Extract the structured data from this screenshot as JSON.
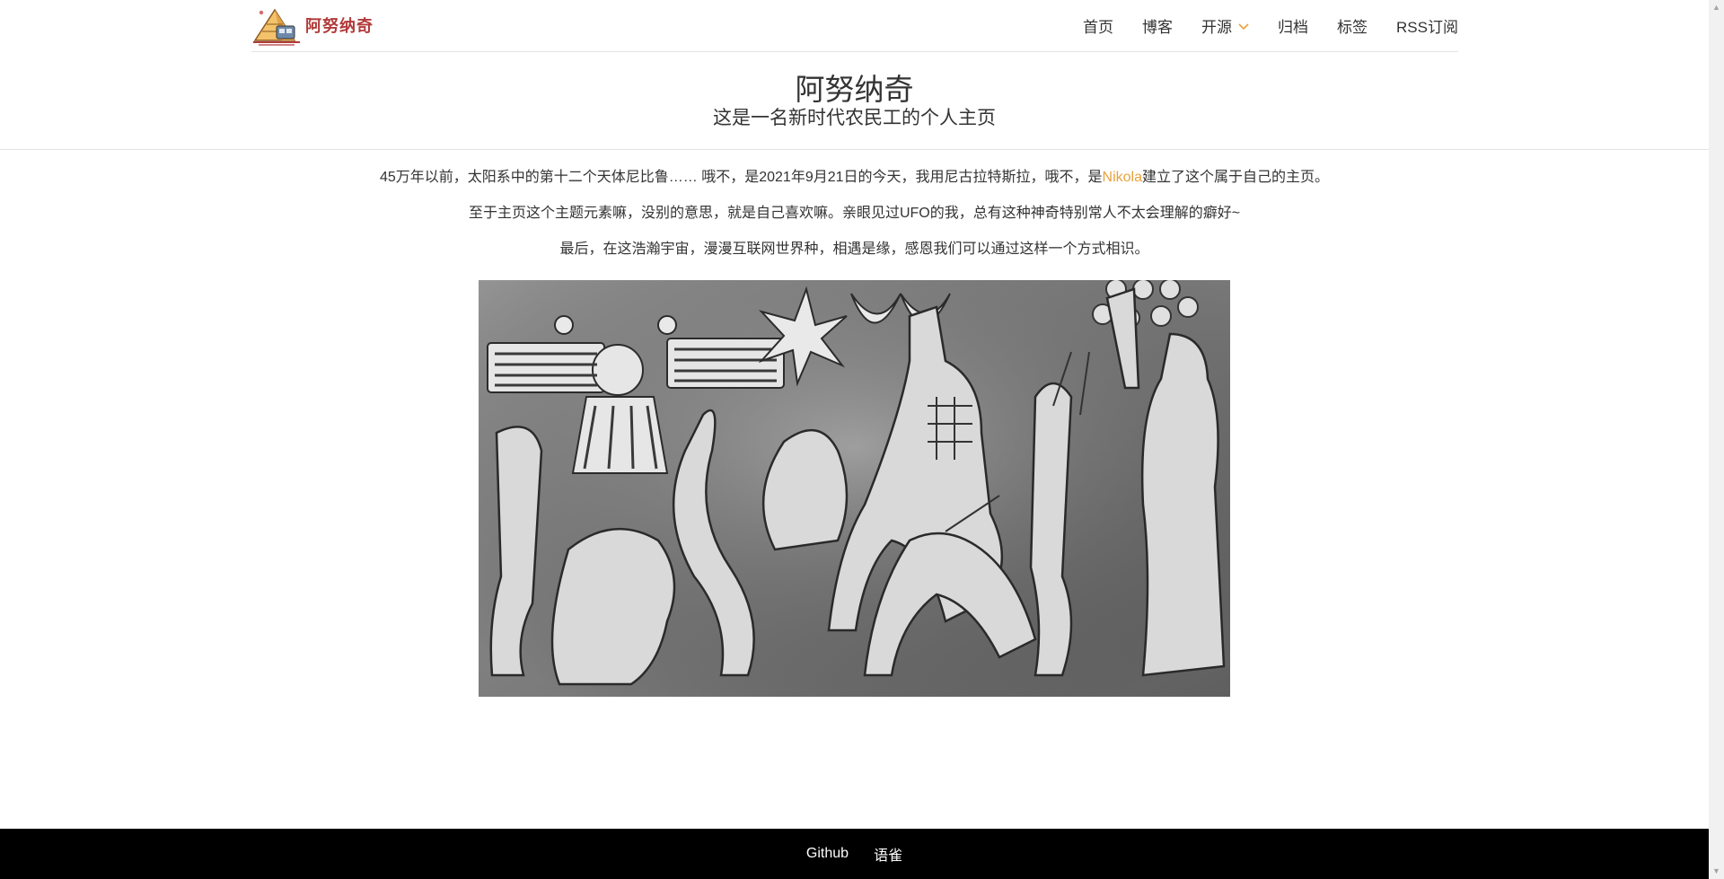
{
  "header": {
    "logo_text": "阿努纳奇",
    "nav": [
      {
        "label": "首页"
      },
      {
        "label": "博客"
      },
      {
        "label": "开源"
      },
      {
        "label": "归档"
      },
      {
        "label": "标签"
      },
      {
        "label": "RSS订阅"
      }
    ],
    "accent_color": "#e8a23c"
  },
  "hero": {
    "title": "阿努纳奇",
    "subtitle": "这是一名新时代农民工的个人主页"
  },
  "content": {
    "line1_before": "45万年以前，太阳系中的第十二个天体尼比鲁…… 哦不，是2021年9月21日的今天，我用尼古拉特斯拉，哦不，是",
    "line1_link": "Nikola",
    "line1_after": "建立了这个属于自己的主页。",
    "line2": "至于主页这个主题元素嘛，没别的意思，就是自己喜欢嘛。亲眼见过UFO的我，总有这种神奇特别常人不太会理解的癖好~",
    "line3": "最后，在这浩瀚宇宙，漫漫互联网世界种，相遇是缘，感恩我们可以通过这样一个方式相识。"
  },
  "footer": {
    "links": [
      {
        "label": "Github"
      },
      {
        "label": "语雀"
      }
    ]
  }
}
